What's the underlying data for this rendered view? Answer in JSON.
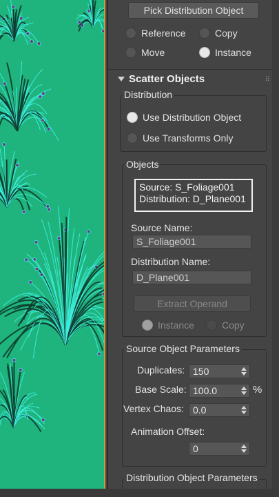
{
  "top": {
    "pick_button": "Pick Distribution Object",
    "radios": [
      {
        "label": "Reference",
        "checked": false
      },
      {
        "label": "Copy",
        "checked": false
      },
      {
        "label": "Move",
        "checked": false
      },
      {
        "label": "Instance",
        "checked": true
      }
    ]
  },
  "rollout": {
    "title": "Scatter Objects"
  },
  "distribution": {
    "title": "Distribution",
    "options": [
      {
        "label": "Use Distribution Object",
        "checked": true
      },
      {
        "label": "Use Transforms Only",
        "checked": false
      }
    ]
  },
  "objects": {
    "title": "Objects",
    "list_line1": "Source: S_Foliage001",
    "list_line2": "Distribution: D_Plane001",
    "source_name_label": "Source Name:",
    "source_name_value": "S_Foliage001",
    "distribution_name_label": "Distribution Name:",
    "distribution_name_value": "D_Plane001",
    "extract_button": "Extract Operand",
    "extract_options": [
      {
        "label": "Instance",
        "checked": true
      },
      {
        "label": "Copy",
        "checked": false
      }
    ]
  },
  "source_params": {
    "title": "Source Object Parameters",
    "duplicates_label": "Duplicates:",
    "duplicates_value": "150",
    "base_scale_label": "Base Scale:",
    "base_scale_value": "100.0",
    "base_scale_unit": "%",
    "vertex_chaos_label": "Vertex Chaos:",
    "vertex_chaos_value": "0.0",
    "anim_offset_label": "Animation Offset:",
    "anim_offset_value": "0"
  },
  "distribution_params": {
    "title": "Distribution Object Parameters"
  },
  "colors": {
    "viewport_bg": "#1fb47e",
    "wire": "#3ef0e0",
    "panel_bg": "#444444"
  }
}
